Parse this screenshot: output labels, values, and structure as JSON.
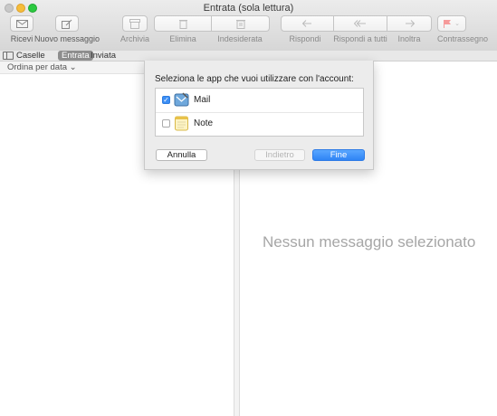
{
  "window": {
    "title": "Entrata (sola lettura)"
  },
  "toolbar": {
    "get_mail": "Ricevi",
    "new_message": "Nuovo messaggio",
    "archive": "Archivia",
    "delete": "Elimina",
    "junk": "Indesiderata",
    "reply": "Rispondi",
    "reply_all": "Rispondi a tutti",
    "forward": "Inoltra",
    "flag": "Contrassegno"
  },
  "favorites": {
    "mailboxes": "Caselle",
    "inbox": "Entrata",
    "sent": "Inviata"
  },
  "list": {
    "sort_label": "Ordina per data ⌄"
  },
  "message_pane": {
    "empty_text": "Nessun messaggio selezionato"
  },
  "dialog": {
    "prompt": "Seleziona le app che vuoi utilizzare con l'account:",
    "apps": [
      {
        "name": "Mail",
        "checked": true
      },
      {
        "name": "Note",
        "checked": false
      }
    ],
    "cancel": "Annulla",
    "back": "Indietro",
    "done": "Fine"
  },
  "colors": {
    "accent": "#3b8ef5",
    "flag": "#f36b6b"
  }
}
